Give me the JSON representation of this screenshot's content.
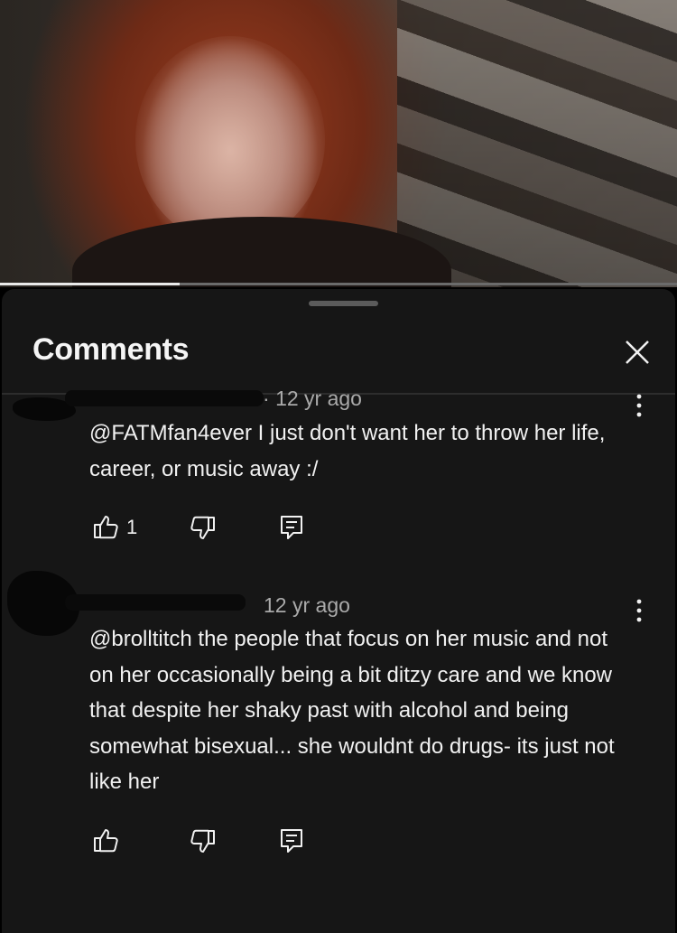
{
  "video": {
    "progress_fraction": 0.265
  },
  "sheet": {
    "title": "Comments",
    "close_icon": "close-icon"
  },
  "comments": [
    {
      "timestamp": "12 yr ago",
      "text": "@FATMfan4ever I just don't want her to throw her life, career, or music away :/",
      "like_count": "1"
    },
    {
      "timestamp": "12 yr ago",
      "text": "@brolltitch the people that  focus on her music and not on her occasionally being a bit ditzy care and we know that despite her shaky past with alcohol and being somewhat bisexual... she wouldnt do drugs- its just not like her",
      "like_count": ""
    }
  ],
  "icons": {
    "like": "thumbs-up-icon",
    "dislike": "thumbs-down-icon",
    "reply": "reply-icon",
    "menu": "more-vertical-icon"
  }
}
